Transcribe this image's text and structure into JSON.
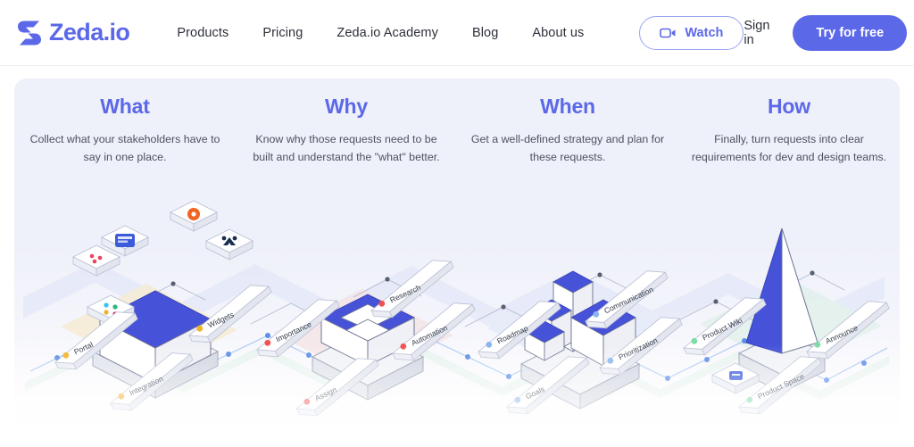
{
  "brand": {
    "name": "Zeda.io",
    "logo_icon": "zeda-logo-icon",
    "color": "#5b68e8"
  },
  "header": {
    "nav": [
      {
        "label": "Products"
      },
      {
        "label": "Pricing"
      },
      {
        "label": "Zeda.io Academy"
      },
      {
        "label": "Blog"
      },
      {
        "label": "About us"
      }
    ],
    "watch": {
      "label": "Watch",
      "icon": "video-camera-icon"
    },
    "sign_in": {
      "label": "Sign in"
    },
    "try_free": {
      "label": "Try for free"
    }
  },
  "hero": {
    "columns": [
      {
        "title": "What",
        "description": "Collect what your stakeholders have to say in one place.",
        "labels": [
          "Portal",
          "Widgets",
          "Integration"
        ],
        "accent": "#f6e7c0"
      },
      {
        "title": "Why",
        "description": "Know why those requests need to be built and understand the \"what\" better.",
        "labels": [
          "Importance",
          "Research",
          "Automation",
          "Assign"
        ],
        "accent": "#f3dcdc"
      },
      {
        "title": "When",
        "description": "Get a well-defined strategy and plan for these requests.",
        "labels": [
          "Roadmap",
          "Communication",
          "Prioritization",
          "Goals"
        ],
        "accent": "#dbe6f7"
      },
      {
        "title": "How",
        "description": "Finally, turn requests into clear requirements for dev and design teams.",
        "labels": [
          "Product Wiki",
          "Announce",
          "Product Space"
        ],
        "accent": "#d9efe2"
      }
    ]
  },
  "colors": {
    "accent": "#5b68e8",
    "panel_top": "#eef0fa",
    "text": "#2c3038",
    "muted": "#4d5360"
  }
}
